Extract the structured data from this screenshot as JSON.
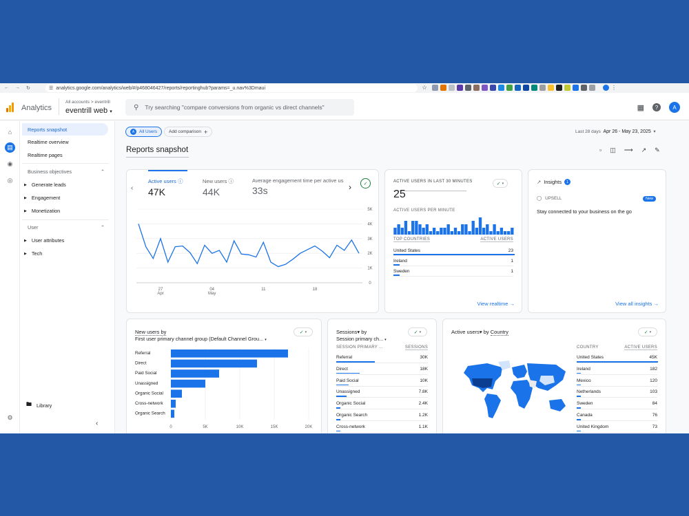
{
  "browser": {
    "url": "analytics.google.com/analytics/web/#/p468046427/reports/reportinghub?params=_u.nav%3Dmaui"
  },
  "header": {
    "app_name": "Analytics",
    "crumb": "All accounts  >  eventrill",
    "property": "eventrill web",
    "search_placeholder": "Try searching \"compare conversions from organic vs direct channels\"",
    "avatar": "A"
  },
  "sidebar": {
    "items": [
      {
        "label": "Reports snapshot"
      },
      {
        "label": "Realtime overview"
      },
      {
        "label": "Realtime pages"
      }
    ],
    "section1": "Business objectives",
    "sub1": [
      {
        "label": "Generate leads"
      },
      {
        "label": "Engagement"
      },
      {
        "label": "Monetization"
      }
    ],
    "section2": "User",
    "sub2": [
      {
        "label": "User attributes"
      },
      {
        "label": "Tech"
      }
    ],
    "library": "Library"
  },
  "toolbar": {
    "all_users": "All Users",
    "all_users_letter": "A",
    "add_comparison": "Add comparison",
    "date_label": "Last 28 days",
    "date_range": "Apr 26 - May 23, 2025",
    "page_title": "Reports snapshot"
  },
  "overview": {
    "metrics": [
      {
        "label": "Active users",
        "value": "47K"
      },
      {
        "label": "New users",
        "value": "44K"
      },
      {
        "label": "Average engagement time per active us",
        "value": "33s"
      }
    ],
    "y_ticks": [
      "5K",
      "4K",
      "3K",
      "2K",
      "1K",
      "0"
    ],
    "x_ticks": [
      {
        "d": "27",
        "m": "Apr"
      },
      {
        "d": "04",
        "m": "May"
      },
      {
        "d": "11",
        "m": ""
      },
      {
        "d": "18",
        "m": ""
      }
    ]
  },
  "chart_data": {
    "type": "line",
    "title": "Active users",
    "y": [
      4000,
      2450,
      1650,
      3000,
      1400,
      2450,
      2500,
      2050,
      1300,
      2550,
      2000,
      2200,
      1400,
      2850,
      1950,
      1900,
      1750,
      2750,
      1400,
      1100,
      1250,
      1600,
      2000,
      2250,
      2500,
      2150,
      1700,
      2550,
      2200,
      2900,
      2000
    ],
    "ylim": [
      0,
      5000
    ]
  },
  "realtime": {
    "title": "ACTIVE USERS IN LAST 30 MINUTES",
    "value": "25",
    "per_minute": "ACTIVE USERS PER MINUTE",
    "bars": [
      2,
      3,
      2,
      4,
      1,
      4,
      4,
      3,
      2,
      3,
      1,
      2,
      1,
      2,
      2,
      3,
      1,
      2,
      1,
      3,
      3,
      1,
      4,
      2,
      5,
      2,
      3,
      1,
      3,
      1,
      2,
      1,
      1,
      2
    ],
    "col1": "TOP COUNTRIES",
    "col2": "ACTIVE USERS",
    "rows": [
      {
        "c": "United States",
        "v": "23",
        "p": 1.0
      },
      {
        "c": "Ireland",
        "v": "1",
        "p": 0.05
      },
      {
        "c": "Sweden",
        "v": "1",
        "p": 0.05
      }
    ],
    "link": "View realtime"
  },
  "insights": {
    "title": "Insights",
    "badge": "1",
    "upsell": "UPSELL",
    "new": "New",
    "text": "Stay connected to your business on the go",
    "link": "View all insights"
  },
  "newusers": {
    "title": "New users by",
    "subtitle": "First user primary channel group (Default Channel Grou...",
    "rows": [
      {
        "c": "Referral",
        "v": 17000
      },
      {
        "c": "Direct",
        "v": 12500
      },
      {
        "c": "Paid Social",
        "v": 7000
      },
      {
        "c": "Unassigned",
        "v": 5000
      },
      {
        "c": "Organic Social",
        "v": 1600
      },
      {
        "c": "Cross-network",
        "v": 700
      },
      {
        "c": "Organic Search",
        "v": 500
      }
    ],
    "ticks": [
      "0",
      "5K",
      "10K",
      "15K",
      "20K"
    ],
    "xmax": 20000
  },
  "sessions": {
    "title": "Sessions▾ by",
    "subtitle": "Session primary ch...",
    "col1": "SESSION PRIMARY ...",
    "col2": "SESSIONS",
    "rows": [
      {
        "c": "Referral",
        "v": "30K",
        "p": 1.0
      },
      {
        "c": "Direct",
        "v": "18K",
        "p": 0.6
      },
      {
        "c": "Paid Social",
        "v": "10K",
        "p": 0.33
      },
      {
        "c": "Unassigned",
        "v": "7.8K",
        "p": 0.26
      },
      {
        "c": "Organic Social",
        "v": "2.4K",
        "p": 0.08
      },
      {
        "c": "Organic Search",
        "v": "1.2K",
        "p": 0.04
      },
      {
        "c": "Cross-network",
        "v": "1.1K",
        "p": 0.04
      }
    ]
  },
  "country": {
    "title_a": "Active users▾ by",
    "title_b": "Country",
    "col1": "COUNTRY",
    "col2": "ACTIVE USERS",
    "rows": [
      {
        "c": "United States",
        "v": "45K",
        "p": 1.0
      },
      {
        "c": "Ireland",
        "v": "182",
        "p": 0.02
      },
      {
        "c": "Mexico",
        "v": "120",
        "p": 0.01
      },
      {
        "c": "Netherlands",
        "v": "103",
        "p": 0.01
      },
      {
        "c": "Sweden",
        "v": "84",
        "p": 0.01
      },
      {
        "c": "Canada",
        "v": "76",
        "p": 0.01
      },
      {
        "c": "United Kingdom",
        "v": "73",
        "p": 0.01
      }
    ]
  }
}
